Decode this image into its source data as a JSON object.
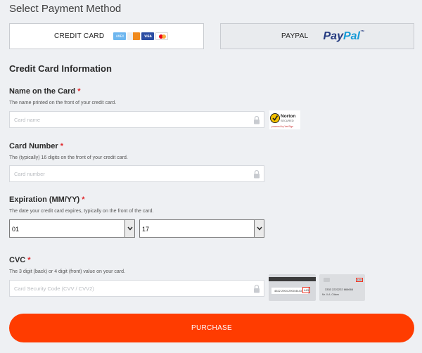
{
  "payment": {
    "section_title": "Select Payment Method",
    "tabs": [
      {
        "label": "CREDIT CARD",
        "selected": true,
        "card_icons": [
          "amex-card-icon",
          "discover-card-icon",
          "visa-card-icon",
          "mastercard-icon"
        ],
        "card_icon_text": {
          "amex": "AMEX",
          "visa": "VISA"
        }
      },
      {
        "label": "PAYPAL",
        "selected": false,
        "logo": {
          "part1": "Pay",
          "part2": "Pal",
          "tm": "™"
        }
      }
    ]
  },
  "form": {
    "heading": "Credit Card Information",
    "name": {
      "label": "Name on the Card",
      "required_mark": "*",
      "hint": "The name printed on the front of your credit card.",
      "placeholder": "Card name",
      "value": ""
    },
    "number": {
      "label": "Card Number",
      "required_mark": "*",
      "hint": "The (typically) 16 digits on the front of your credit card.",
      "placeholder": "Card number",
      "value": ""
    },
    "expiration": {
      "label": "Expiration (MM/YY)",
      "required_mark": "*",
      "hint": "The date your credit card expires, typically on the front of the card.",
      "month": "01",
      "year": "17"
    },
    "cvc": {
      "label": "CVC",
      "required_mark": "*",
      "hint": "The 3 digit (back) or 4 digit (front) value on your card.",
      "placeholder": "Card Security Code (CVV / CVV2)",
      "value": ""
    }
  },
  "trust_badge": {
    "brand": "Norton",
    "sub": "SECURED",
    "powered": "powered by VeriSign"
  },
  "cvc_illustration": {
    "back_card_number": "4522 2904 2900 8443",
    "back_cvv": "443",
    "front_card_number": "3333 2222222 666666",
    "front_cvc": "1234",
    "front_name": "Mr. X.A. Citizen"
  },
  "purchase_button": {
    "label": "PURCHASE"
  },
  "colors": {
    "accent": "#ff3c00",
    "required": "#e0272b",
    "paypal_dark": "#253b80",
    "paypal_light": "#179bd7",
    "background": "#eef0f3"
  }
}
